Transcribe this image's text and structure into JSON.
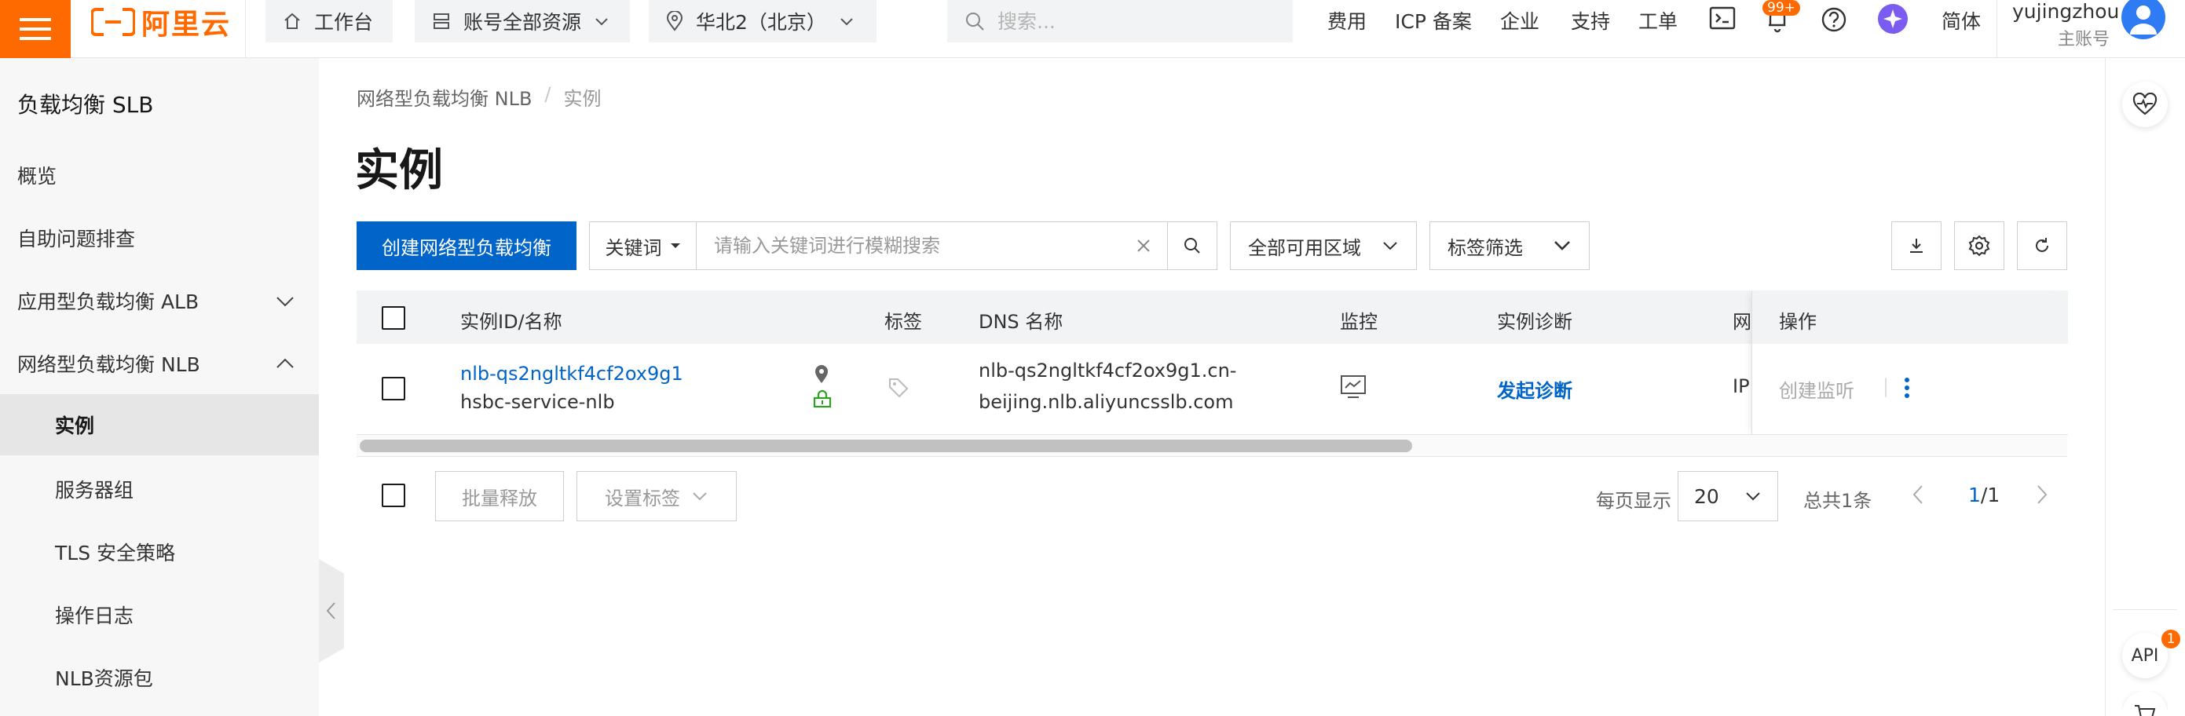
{
  "topbar": {
    "logo_text": "阿里云",
    "home": "工作台",
    "resources": "账号全部资源",
    "region": "华北2（北京）",
    "search_placeholder": "搜索...",
    "links": [
      "费用",
      "ICP 备案",
      "企业",
      "支持",
      "工单"
    ],
    "bell_badge": "99+",
    "language": "简体",
    "user_name": "yujingzhou",
    "user_role": "主账号"
  },
  "sidebar": {
    "title": "负载均衡 SLB",
    "items": [
      {
        "label": "概览"
      },
      {
        "label": "自助问题排查"
      },
      {
        "label": "应用型负载均衡 ALB"
      },
      {
        "label": "网络型负载均衡 NLB"
      },
      {
        "label": "实例"
      },
      {
        "label": "服务器组"
      },
      {
        "label": "TLS 安全策略"
      },
      {
        "label": "操作日志"
      },
      {
        "label": "NLB资源包"
      }
    ]
  },
  "breadcrumb": {
    "parent": "网络型负载均衡 NLB",
    "current": "实例"
  },
  "page_title": "实例",
  "toolbar": {
    "create_label": "创建网络型负载均衡",
    "filter_key": "关键词",
    "filter_placeholder": "请输入关键词进行模糊搜索",
    "zone_filter": "全部可用区域",
    "tag_filter": "标签筛选"
  },
  "table": {
    "headers": {
      "id_name": "实例ID/名称",
      "tags": "标签",
      "dns": "DNS 名称",
      "monitor": "监控",
      "diagnose": "实例诊断",
      "network": "网",
      "ops": "操作"
    },
    "rows": [
      {
        "id": "nlb-qs2ngltkf4cf2ox9g1",
        "name": "hsbc-service-nlb",
        "dns_line1": "nlb-qs2ngltkf4cf2ox9g1.cn-",
        "dns_line2": "beijing.nlb.aliyuncsslb.com",
        "diagnose": "发起诊断",
        "network": "IP",
        "op_create_listener": "创建监听"
      }
    ]
  },
  "footer": {
    "batch_release": "批量释放",
    "set_tags": "设置标签",
    "page_size_label": "每页显示",
    "page_size": "20",
    "total": "总共1条",
    "page_current": "1",
    "page_total": "/1"
  },
  "right_rail": {
    "api_label": "API",
    "api_badge": "1"
  },
  "colors": {
    "brand": "#ff6a00",
    "primary": "#0064c8",
    "ip_icon": "#2ea121"
  }
}
